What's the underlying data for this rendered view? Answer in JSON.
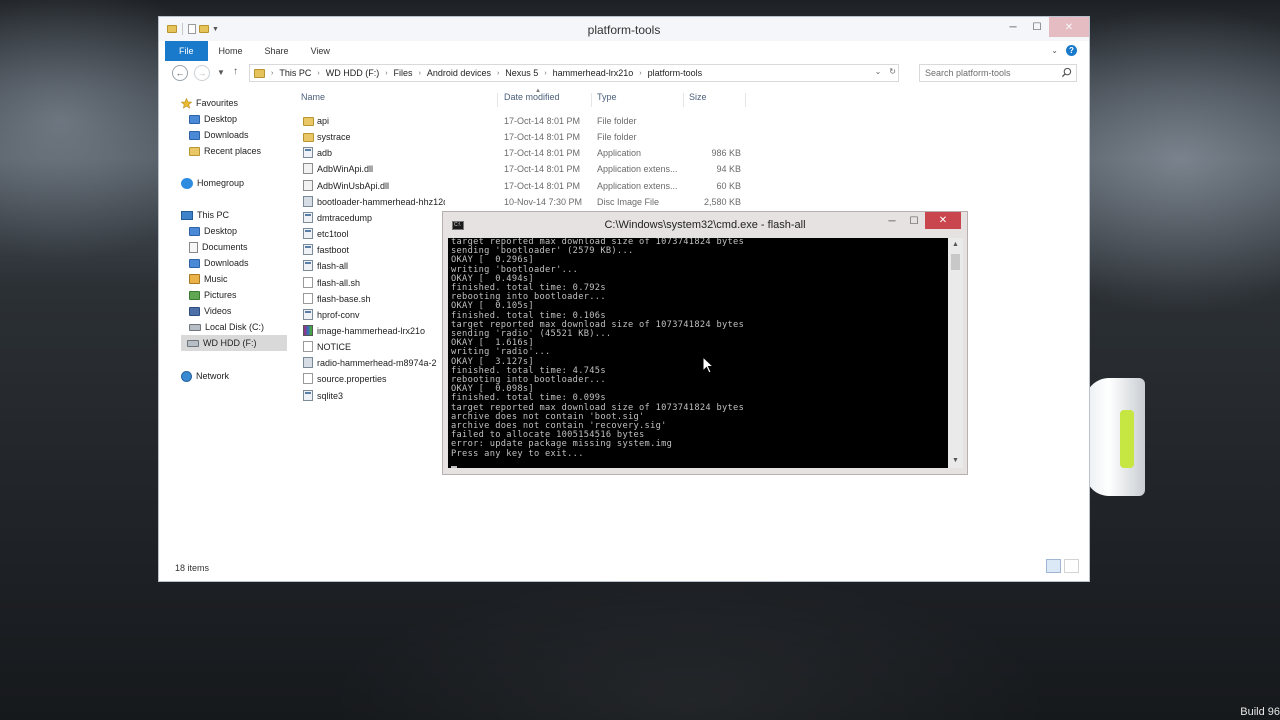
{
  "desktop": {
    "watermark": "Build 96"
  },
  "explorer": {
    "title": "platform-tools",
    "ribbon_tabs": [
      "File",
      "Home",
      "Share",
      "View"
    ],
    "breadcrumb": [
      "This PC",
      "WD HDD (F:)",
      "Files",
      "Android devices",
      "Nexus 5",
      "hammerhead-lrx21o",
      "platform-tools"
    ],
    "search_placeholder": "Search platform-tools",
    "columns": [
      "Name",
      "Date modified",
      "Type",
      "Size"
    ],
    "nav": {
      "favourites": "Favourites",
      "fav_items": [
        "Desktop",
        "Downloads",
        "Recent places"
      ],
      "homegroup": "Homegroup",
      "thispc": "This PC",
      "pc_items": [
        "Desktop",
        "Documents",
        "Downloads",
        "Music",
        "Pictures",
        "Videos",
        "Local Disk (C:)",
        "WD HDD (F:)"
      ],
      "network": "Network"
    },
    "files": [
      {
        "name": "api",
        "date": "17-Oct-14 8:01 PM",
        "type": "File folder",
        "size": "",
        "icon": "folder-icon"
      },
      {
        "name": "systrace",
        "date": "17-Oct-14 8:01 PM",
        "type": "File folder",
        "size": "",
        "icon": "folder-icon"
      },
      {
        "name": "adb",
        "date": "17-Oct-14 8:01 PM",
        "type": "Application",
        "size": "986 KB",
        "icon": "application-icon"
      },
      {
        "name": "AdbWinApi.dll",
        "date": "17-Oct-14 8:01 PM",
        "type": "Application extens...",
        "size": "94 KB",
        "icon": "dll-file-icon"
      },
      {
        "name": "AdbWinUsbApi.dll",
        "date": "17-Oct-14 8:01 PM",
        "type": "Application extens...",
        "size": "60 KB",
        "icon": "dll-file-icon"
      },
      {
        "name": "bootloader-hammerhead-hhz12d",
        "date": "10-Nov-14 7:30 PM",
        "type": "Disc Image File",
        "size": "2,580 KB",
        "icon": "disc-image-icon"
      },
      {
        "name": "dmtracedump",
        "date": "",
        "type": "",
        "size": "",
        "icon": "application-icon"
      },
      {
        "name": "etc1tool",
        "date": "",
        "type": "",
        "size": "",
        "icon": "application-icon"
      },
      {
        "name": "fastboot",
        "date": "",
        "type": "",
        "size": "",
        "icon": "application-icon"
      },
      {
        "name": "flash-all",
        "date": "",
        "type": "",
        "size": "",
        "icon": "batch-file-icon"
      },
      {
        "name": "flash-all.sh",
        "date": "",
        "type": "",
        "size": "",
        "icon": "blank-file-icon"
      },
      {
        "name": "flash-base.sh",
        "date": "",
        "type": "",
        "size": "",
        "icon": "blank-file-icon"
      },
      {
        "name": "hprof-conv",
        "date": "",
        "type": "",
        "size": "",
        "icon": "application-icon"
      },
      {
        "name": "image-hammerhead-lrx21o",
        "date": "",
        "type": "",
        "size": "",
        "icon": "archive-icon"
      },
      {
        "name": "NOTICE",
        "date": "",
        "type": "",
        "size": "",
        "icon": "blank-file-icon"
      },
      {
        "name": "radio-hammerhead-m8974a-2",
        "date": "",
        "type": "",
        "size": "",
        "icon": "disc-image-icon"
      },
      {
        "name": "source.properties",
        "date": "",
        "type": "",
        "size": "",
        "icon": "blank-file-icon"
      },
      {
        "name": "sqlite3",
        "date": "",
        "type": "",
        "size": "",
        "icon": "application-icon"
      }
    ],
    "status": "18 items"
  },
  "cmd": {
    "title": "C:\\Windows\\system32\\cmd.exe - flash-all",
    "icon_label": "C:\\",
    "lines": [
      "target reported max download size of 1073741824 bytes",
      "sending 'bootloader' (2579 KB)...",
      "OKAY [  0.296s]",
      "writing 'bootloader'...",
      "OKAY [  0.494s]",
      "finished. total time: 0.792s",
      "rebooting into bootloader...",
      "OKAY [  0.105s]",
      "finished. total time: 0.106s",
      "target reported max download size of 1073741824 bytes",
      "sending 'radio' (45521 KB)...",
      "OKAY [  1.616s]",
      "writing 'radio'...",
      "OKAY [  3.127s]",
      "finished. total time: 4.745s",
      "rebooting into bootloader...",
      "OKAY [  0.098s]",
      "finished. total time: 0.099s",
      "target reported max download size of 1073741824 bytes",
      "archive does not contain 'boot.sig'",
      "archive does not contain 'recovery.sig'",
      "failed to allocate 1005154516 bytes",
      "error: update package missing system.img",
      "Press any key to exit..."
    ]
  },
  "colors": {
    "file_tab": "#1979ca",
    "close_button": "#c9464f",
    "console_bg": "#000000",
    "console_text": "#c0c0c0"
  }
}
